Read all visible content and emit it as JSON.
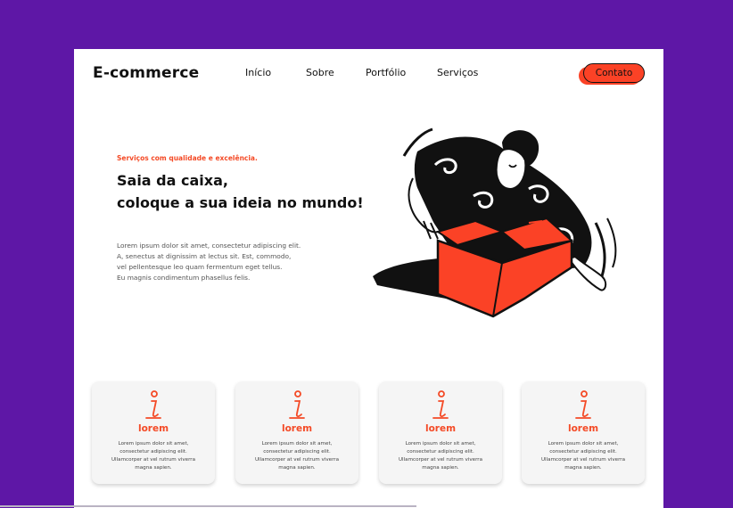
{
  "header": {
    "logo": "E-commerce",
    "nav": [
      {
        "label": "Início"
      },
      {
        "label": "Sobre"
      },
      {
        "label": "Portfólio"
      },
      {
        "label": "Serviços"
      }
    ],
    "contact_label": "Contato"
  },
  "hero": {
    "tagline": "Serviços com qualidade e excelência.",
    "headline_line1": "Saia da caixa,",
    "headline_line2": "coloque a sua ideia no mundo!",
    "body_lines": [
      "Lorem ipsum dolor sit amet, consectetur adipiscing elit.",
      "A, senectus at dignissim at lectus sit. Est, commodo,",
      "vel pellentesque leo quam fermentum eget tellus.",
      "Eu magnis condimentum phasellus felis."
    ]
  },
  "cards": [
    {
      "icon": "info-icon",
      "title": "lorem",
      "text": "Lorem ipsum dolor sit amet, consectetur adipiscing elit. Ullamcorper at vel rutrum viverra magna sapien."
    },
    {
      "icon": "info-icon",
      "title": "lorem",
      "text": "Lorem ipsum dolor sit amet, consectetur adipiscing elit. Ullamcorper at vel rutrum viverra magna sapien."
    },
    {
      "icon": "info-icon",
      "title": "lorem",
      "text": "Lorem ipsum dolor sit amet, consectetur adipiscing elit. Ullamcorper at vel rutrum viverra magna sapien."
    },
    {
      "icon": "info-icon",
      "title": "lorem",
      "text": "Lorem ipsum dolor sit amet, consectetur adipiscing elit. Ullamcorper at vel rutrum viverra magna sapien."
    }
  ],
  "colors": {
    "background": "#5e17a6",
    "accent": "#fb4226",
    "accent_text": "#f44a26",
    "text": "#111111"
  }
}
